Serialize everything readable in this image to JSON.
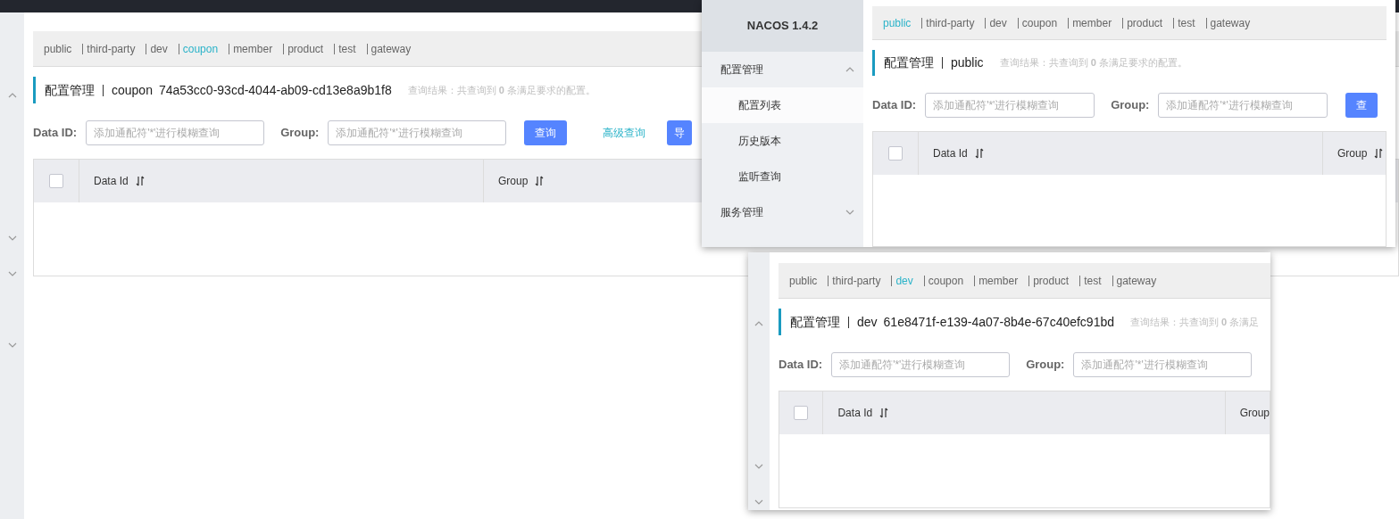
{
  "windows": [
    {
      "kind": "strip",
      "namespaces": [
        {
          "label": "public",
          "selected": false
        },
        {
          "label": "third-party",
          "selected": false
        },
        {
          "label": "dev",
          "selected": false
        },
        {
          "label": "coupon",
          "selected": true
        },
        {
          "label": "member",
          "selected": false
        },
        {
          "label": "product",
          "selected": false
        },
        {
          "label": "test",
          "selected": false
        },
        {
          "label": "gateway",
          "selected": false
        }
      ],
      "title": {
        "section": "配置管理",
        "namespace": "coupon",
        "namespace_id": "74a53cc0-93cd-4044-ab09-cd13e8a9b1f8"
      },
      "result_hint": "查询结果：共查询到 **0** 条满足要求的配置。",
      "filters": [
        {
          "label": "Data ID:",
          "placeholder": "添加通配符'*'进行模糊查询"
        },
        {
          "label": "Group:",
          "placeholder": "添加通配符'*'进行模糊查询"
        }
      ],
      "buttons": [
        {
          "label": "查询",
          "kind": "primary"
        },
        {
          "label": "高级查询",
          "kind": "link"
        },
        {
          "label": "导",
          "kind": "primary"
        }
      ],
      "table": {
        "select_all_checked": false,
        "columns": [
          {
            "label": "Data Id",
            "sortable": true
          },
          {
            "label": "Group",
            "sortable": true
          }
        ]
      }
    },
    {
      "kind": "sidebar",
      "sidebar": {
        "logo": "NACOS 1.4.2",
        "menu": [
          {
            "label": "配置管理",
            "expanded": true,
            "children": [
              {
                "label": "配置列表",
                "selected": true
              },
              {
                "label": "历史版本",
                "selected": false
              },
              {
                "label": "监听查询",
                "selected": false
              }
            ]
          },
          {
            "label": "服务管理",
            "expanded": false
          }
        ]
      },
      "namespaces": [
        {
          "label": "public",
          "selected": true
        },
        {
          "label": "third-party",
          "selected": false
        },
        {
          "label": "dev",
          "selected": false
        },
        {
          "label": "coupon",
          "selected": false
        },
        {
          "label": "member",
          "selected": false
        },
        {
          "label": "product",
          "selected": false
        },
        {
          "label": "test",
          "selected": false
        },
        {
          "label": "gateway",
          "selected": false
        }
      ],
      "title": {
        "section": "配置管理",
        "namespace": "public"
      },
      "result_hint": "查询结果：共查询到 **0** 条满足要求的配置。",
      "filters": [
        {
          "label": "Data ID:",
          "placeholder": "添加通配符'*'进行模糊查询"
        },
        {
          "label": "Group:",
          "placeholder": "添加通配符'*'进行模糊查询"
        }
      ],
      "buttons": [
        {
          "label": "查",
          "kind": "primary"
        }
      ],
      "table": {
        "select_all_checked": false,
        "columns": [
          {
            "label": "Data Id",
            "sortable": true
          },
          {
            "label": "Group",
            "sortable": true
          }
        ]
      }
    },
    {
      "kind": "strip",
      "namespaces": [
        {
          "label": "public",
          "selected": false
        },
        {
          "label": "third-party",
          "selected": false
        },
        {
          "label": "dev",
          "selected": true
        },
        {
          "label": "coupon",
          "selected": false
        },
        {
          "label": "member",
          "selected": false
        },
        {
          "label": "product",
          "selected": false
        },
        {
          "label": "test",
          "selected": false
        },
        {
          "label": "gateway",
          "selected": false
        }
      ],
      "title": {
        "section": "配置管理",
        "namespace": "dev",
        "namespace_id": "61e8471f-e139-4a07-8b4e-67c40efc91bd"
      },
      "result_hint": "查询结果：共查询到 **0** 条满足",
      "filters": [
        {
          "label": "Data ID:",
          "placeholder": "添加通配符'*'进行模糊查询"
        },
        {
          "label": "Group:",
          "placeholder": "添加通配符'*'进行模糊查询"
        }
      ],
      "table": {
        "select_all_checked": false,
        "columns": [
          {
            "label": "Data Id",
            "sortable": true
          },
          {
            "label": "Group",
            "sortable": false
          }
        ]
      }
    }
  ]
}
